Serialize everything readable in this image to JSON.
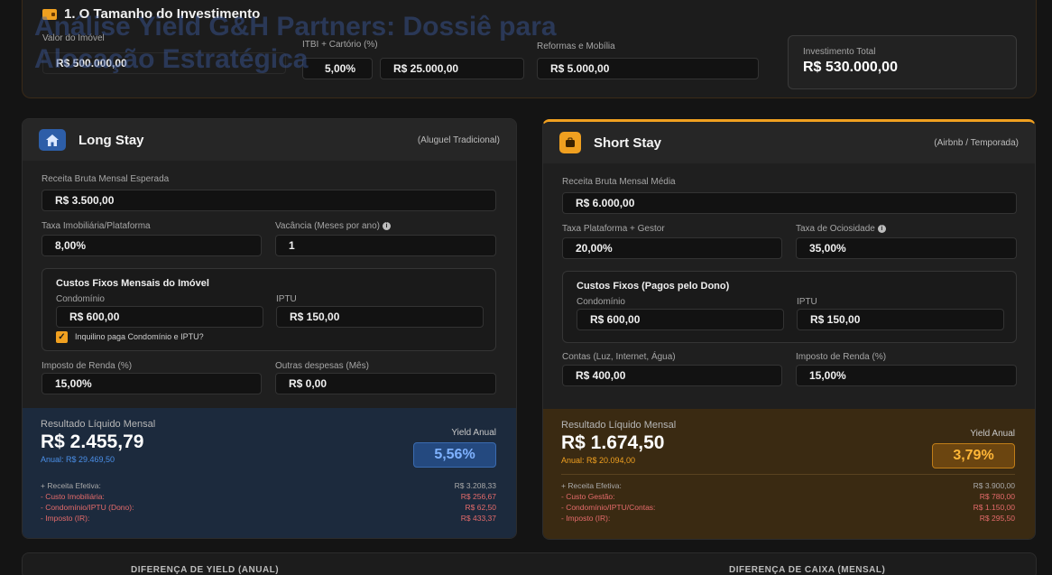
{
  "header": {
    "title": "1. O Tamanho do Investimento",
    "overlay_title": "Análise Yield G&H Partners: Dossiê para Alocação Estratégica"
  },
  "investment": {
    "property_value_label": "Valor do Imóvel",
    "property_value": "R$ 500.000,00",
    "itbi_label": "ITBI + Cartório (%)",
    "itbi_percent": "5,00%",
    "itbi_value": "R$ 25.000,00",
    "reforms_label": "Reformas e Mobília",
    "reforms_value": "R$ 5.000,00",
    "total_label": "Investimento Total",
    "total_value": "R$ 530.000,00"
  },
  "long_stay": {
    "title": "Long Stay",
    "subtitle": "(Aluguel Tradicional)",
    "revenue_label": "Receita Bruta Mensal Esperada",
    "revenue_value": "R$ 3.500,00",
    "fee_label": "Taxa Imobiliária/Plataforma",
    "fee_value": "8,00%",
    "vacancy_label": "Vacância (Meses por ano)",
    "vacancy_value": "1",
    "fixed_title": "Custos Fixos Mensais do Imóvel",
    "condo_label": "Condomínio",
    "condo_value": "R$ 600,00",
    "iptu_label": "IPTU",
    "iptu_value": "R$ 150,00",
    "tenant_pays_label": "Inquilino paga Condomínio e IPTU?",
    "tax_label": "Imposto de Renda (%)",
    "tax_value": "15,00%",
    "other_label": "Outras despesas (Mês)",
    "other_value": "R$ 0,00",
    "result_label": "Resultado Líquido Mensal",
    "result_value": "R$ 2.455,79",
    "annual": "Anual: R$ 29.469,50",
    "yield_label": "Yield Anual",
    "yield_value": "5,56%",
    "breakdown": [
      {
        "label": "+ Receita Efetiva:",
        "value": "R$ 3.208,33",
        "kind": "pos"
      },
      {
        "label": "- Custo Imobiliária:",
        "value": "R$ 256,67",
        "kind": "neg"
      },
      {
        "label": "- Condomínio/IPTU (Dono):",
        "value": "R$ 62,50",
        "kind": "neg"
      },
      {
        "label": "- Imposto (IR):",
        "value": "R$ 433,37",
        "kind": "neg"
      }
    ]
  },
  "short_stay": {
    "title": "Short Stay",
    "subtitle": "(Airbnb / Temporada)",
    "revenue_label": "Receita Bruta Mensal Média",
    "revenue_value": "R$ 6.000,00",
    "fee_label": "Taxa Plataforma + Gestor",
    "fee_value": "20,00%",
    "idle_label": "Taxa de Ociosidade",
    "idle_value": "35,00%",
    "fixed_title": "Custos Fixos (Pagos pelo Dono)",
    "condo_label": "Condomínio",
    "condo_value": "R$ 600,00",
    "iptu_label": "IPTU",
    "iptu_value": "R$ 150,00",
    "bills_label": "Contas (Luz, Internet, Água)",
    "bills_value": "R$ 400,00",
    "tax_label": "Imposto de Renda (%)",
    "tax_value": "15,00%",
    "result_label": "Resultado Líquido Mensal",
    "result_value": "R$ 1.674,50",
    "annual": "Anual: R$ 20.094,00",
    "yield_label": "Yield Anual",
    "yield_value": "3,79%",
    "breakdown": [
      {
        "label": "+ Receita Efetiva:",
        "value": "R$ 3.900,00",
        "kind": "pos"
      },
      {
        "label": "- Custo Gestão:",
        "value": "R$ 780,00",
        "kind": "neg"
      },
      {
        "label": "- Condomínio/IPTU/Contas:",
        "value": "R$ 1.150,00",
        "kind": "neg"
      },
      {
        "label": "- Imposto (IR):",
        "value": "R$ 295,50",
        "kind": "neg"
      }
    ]
  },
  "bottom": {
    "yield_diff_label": "DIFERENÇA DE YIELD (ANUAL)",
    "cash_diff_label": "DIFERENÇA DE CAIXA (MENSAL)"
  },
  "colors": {
    "accent": "#f0a020",
    "long_accent": "#3a7bd5",
    "negative": "#e46b6b"
  },
  "icons": {
    "header": "wallet-icon",
    "long_stay": "home-icon",
    "short_stay": "suitcase-icon",
    "info": "info-icon",
    "checkbox": "check-icon"
  }
}
